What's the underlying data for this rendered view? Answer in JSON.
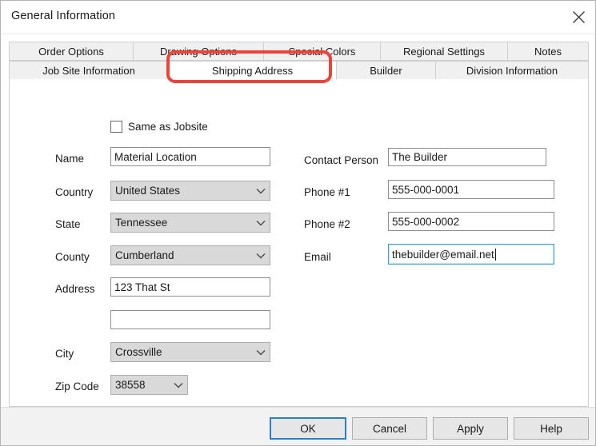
{
  "window": {
    "title": "General Information",
    "close_icon": "close-icon"
  },
  "tabs": {
    "row1": [
      {
        "label": "Order Options",
        "selected": false
      },
      {
        "label": "Drawing Options",
        "selected": false
      },
      {
        "label": "Special Colors",
        "selected": false
      },
      {
        "label": "Regional Settings",
        "selected": false
      },
      {
        "label": "Notes",
        "selected": false
      }
    ],
    "row2": [
      {
        "label": "Job Site Information",
        "selected": false
      },
      {
        "label": "Shipping Address",
        "selected": true
      },
      {
        "label": "Builder",
        "selected": false
      },
      {
        "label": "Division Information",
        "selected": false
      }
    ]
  },
  "highlight": {
    "target": "Shipping Address",
    "color": "#ee4338"
  },
  "form": {
    "same_as_jobsite": {
      "label": "Same as Jobsite",
      "checked": false
    },
    "left": {
      "name": {
        "label": "Name",
        "value": "Material Location"
      },
      "country": {
        "label": "Country",
        "value": "United States"
      },
      "state": {
        "label": "State",
        "value": "Tennessee"
      },
      "county": {
        "label": "County",
        "value": "Cumberland"
      },
      "address1": {
        "label": "Address",
        "value": "123 That St"
      },
      "address2": {
        "label": "",
        "value": ""
      },
      "city": {
        "label": "City",
        "value": "Crossville"
      },
      "zip": {
        "label": "Zip Code",
        "value": "38558"
      }
    },
    "right": {
      "contact": {
        "label": "Contact Person",
        "value": "The Builder"
      },
      "phone1": {
        "label": "Phone #1",
        "value": "555-000-0001"
      },
      "phone2": {
        "label": "Phone #2",
        "value": "555-000-0002"
      },
      "email": {
        "label": "Email",
        "value": "thebuilder@email.net",
        "focused": true
      }
    }
  },
  "footer": {
    "ok": "OK",
    "cancel": "Cancel",
    "apply": "Apply",
    "help": "Help"
  },
  "colors": {
    "accent_focus": "#3b9cd9",
    "default_button_border": "#2a7fc9",
    "combo_bg": "#d9d9d9",
    "tab_bg": "#f0f0f0",
    "highlight": "#ee4338"
  }
}
